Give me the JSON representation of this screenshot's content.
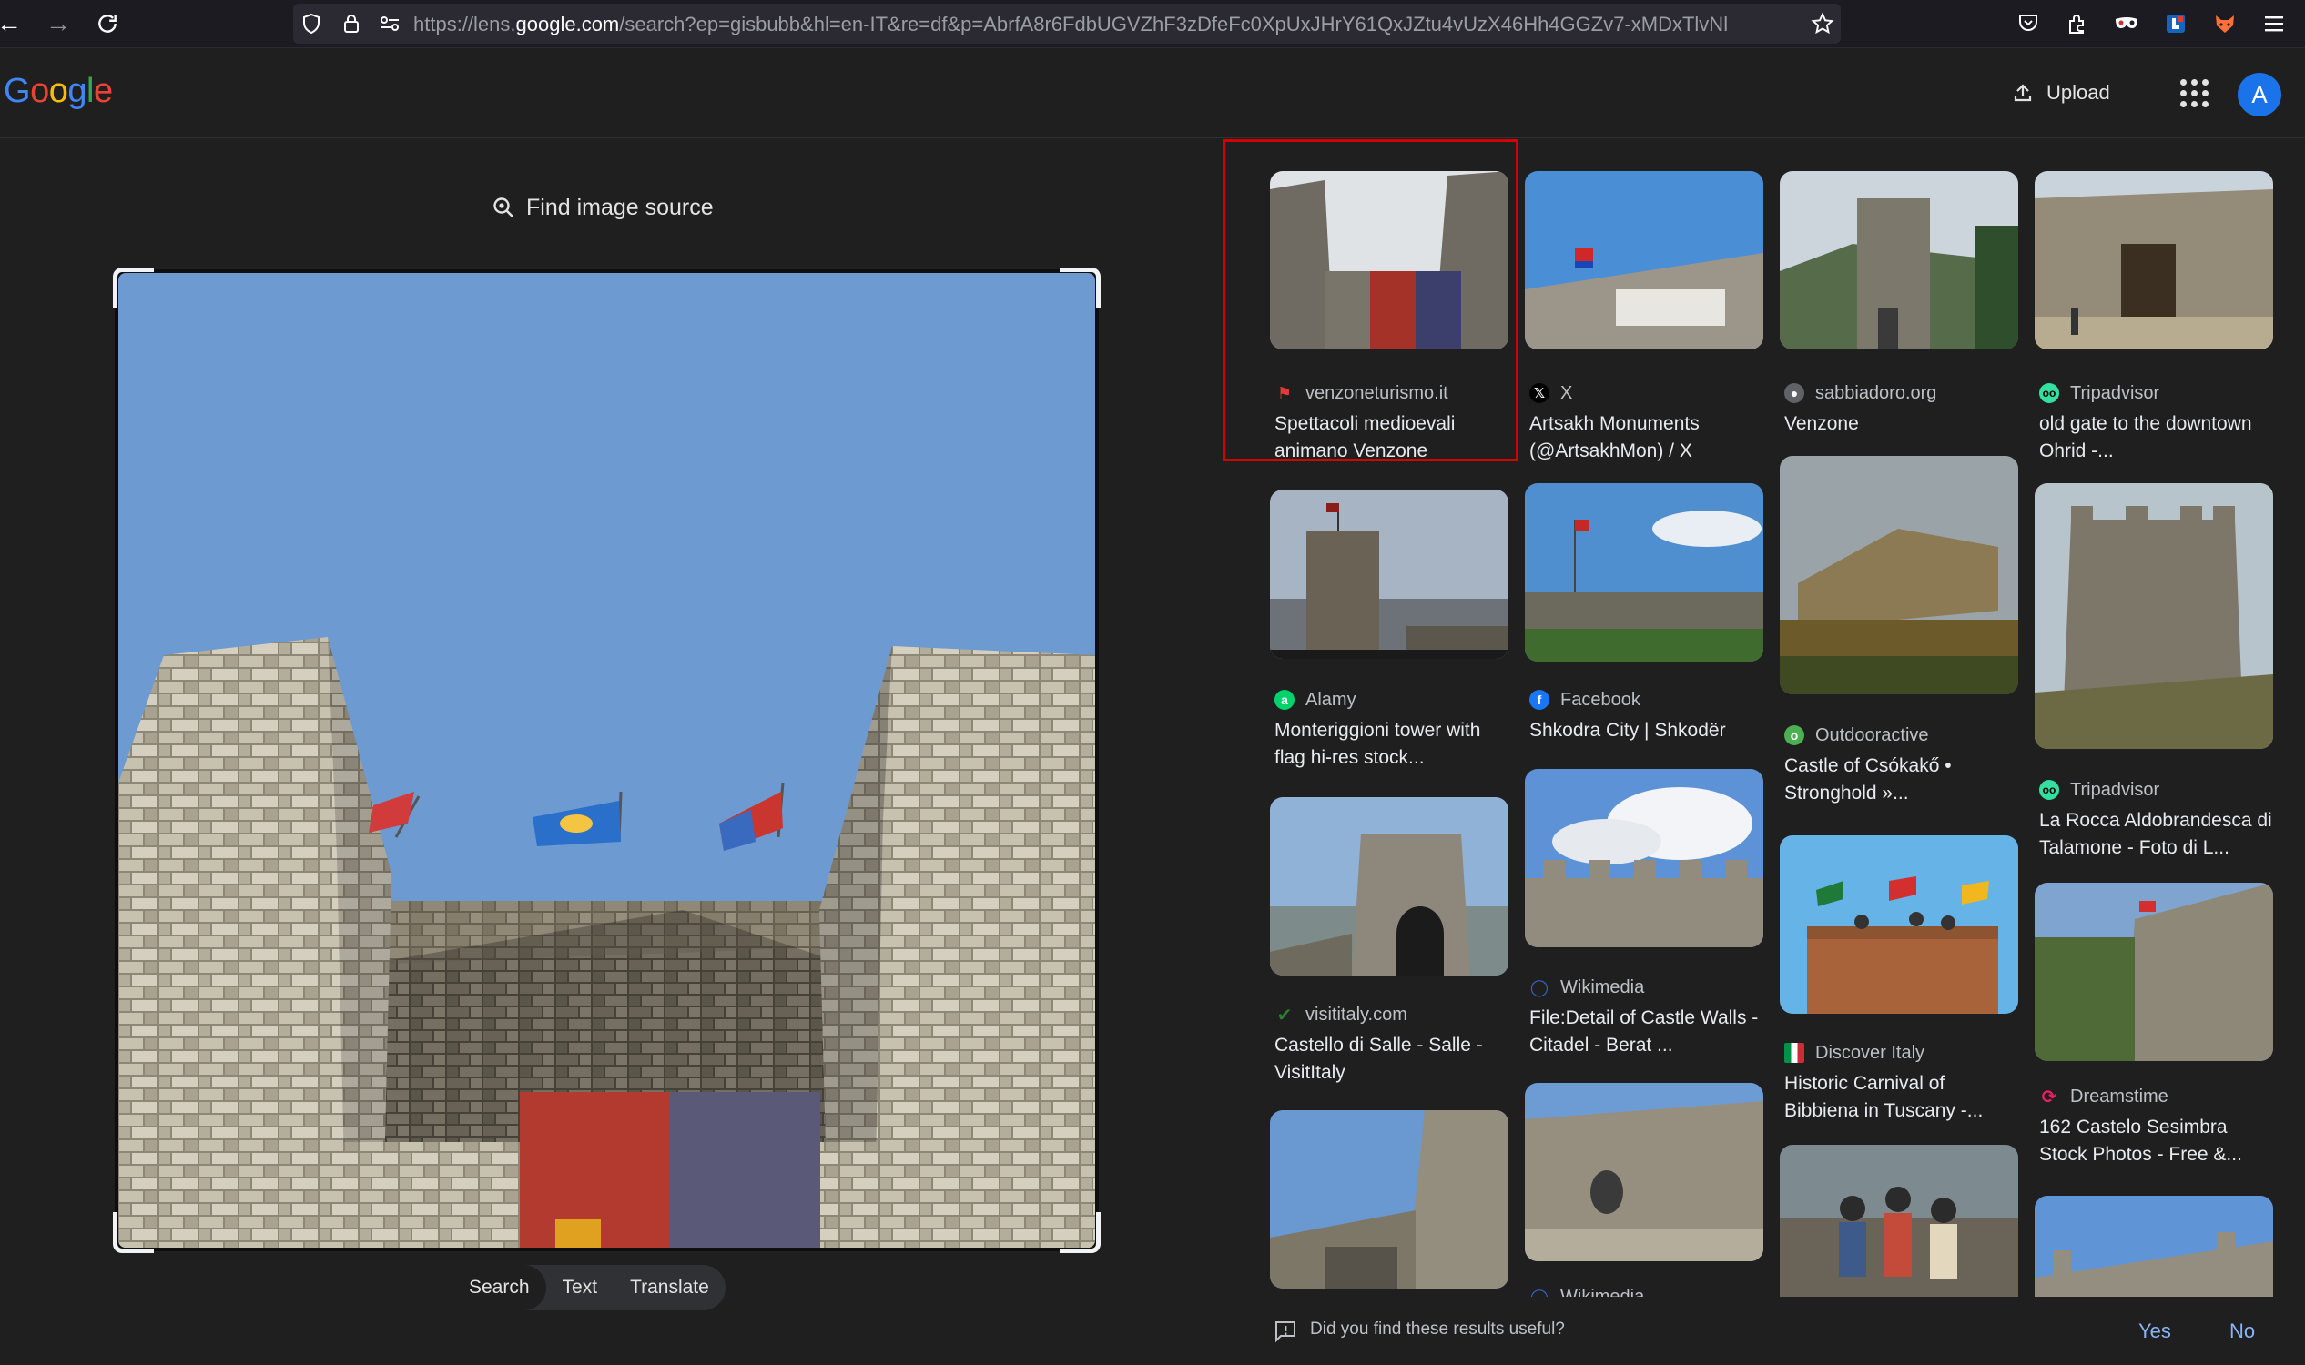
{
  "browser": {
    "url_prefix": "https://lens.",
    "url_domain": "google.com",
    "url_rest": "/search?ep=gisbubb&hl=en-IT&re=df&p=AbrfA8r6FdbUGVZhF3zDfeFc0XpUxJHrY61QxJZtu4vUzX46Hh4GGZv7-xMDxTlvNl"
  },
  "header": {
    "logo": "Google",
    "upload_label": "Upload",
    "avatar_letter": "A"
  },
  "left": {
    "find_source_label": "Find image source",
    "tabs": [
      "Search",
      "Text",
      "Translate"
    ]
  },
  "results": [
    {
      "source": "venzoneturismo.it",
      "title": "Spettacoli medioevali animano Venzone",
      "fav": "pin",
      "fav_color": "#e53935"
    },
    {
      "source": "X",
      "title": "Artsakh Monuments (@ArtsakhMon) / X",
      "fav": "X",
      "fav_color": "#000000"
    },
    {
      "source": "sabbiadoro.org",
      "title": "Venzone",
      "fav": "globe",
      "fav_color": "#5f6368"
    },
    {
      "source": "Tripadvisor",
      "title": "old gate to the downtown Ohrid -...",
      "fav": "owl",
      "fav_color": "#34e0a1"
    },
    {
      "source": "Alamy",
      "title": "Monteriggioni tower with flag hi-res stock...",
      "fav": "a",
      "fav_color": "#00d36b"
    },
    {
      "source": "Facebook",
      "title": "Shkodra City | Shkodër",
      "fav": "f",
      "fav_color": "#1877f2"
    },
    {
      "source": "Outdooractive",
      "title": "Castle of Csókakő • Stronghold »...",
      "fav": "o",
      "fav_color": "#4caf50"
    },
    {
      "source": "Tripadvisor",
      "title": "La Rocca Aldobrandesca di Talamone - Foto di L...",
      "fav": "owl",
      "fav_color": "#34e0a1"
    },
    {
      "source": "visititaly.com",
      "title": "Castello di Salle - Salle - VisitItaly",
      "fav": "v",
      "fav_color": "#2e7d32"
    },
    {
      "source": "Wikimedia",
      "title": "File:Detail of Castle Walls - Citadel - Berat ...",
      "fav": "w",
      "fav_color": "#3366cc"
    },
    {
      "source": "Discover Italy",
      "title": "Historic Carnival of Bibbiena in Tuscany -...",
      "fav": "it",
      "fav_color": "#009246"
    },
    {
      "source": "Dreamstime",
      "title": "162 Castelo Sesimbra Stock Photos - Free &...",
      "fav": "d",
      "fav_color": "#e91e63"
    },
    {
      "source": "Wikimedia",
      "title": "",
      "fav": "w",
      "fav_color": "#3366cc"
    }
  ],
  "feedback": {
    "question": "Did you find these results useful?",
    "yes": "Yes",
    "no": "No"
  }
}
